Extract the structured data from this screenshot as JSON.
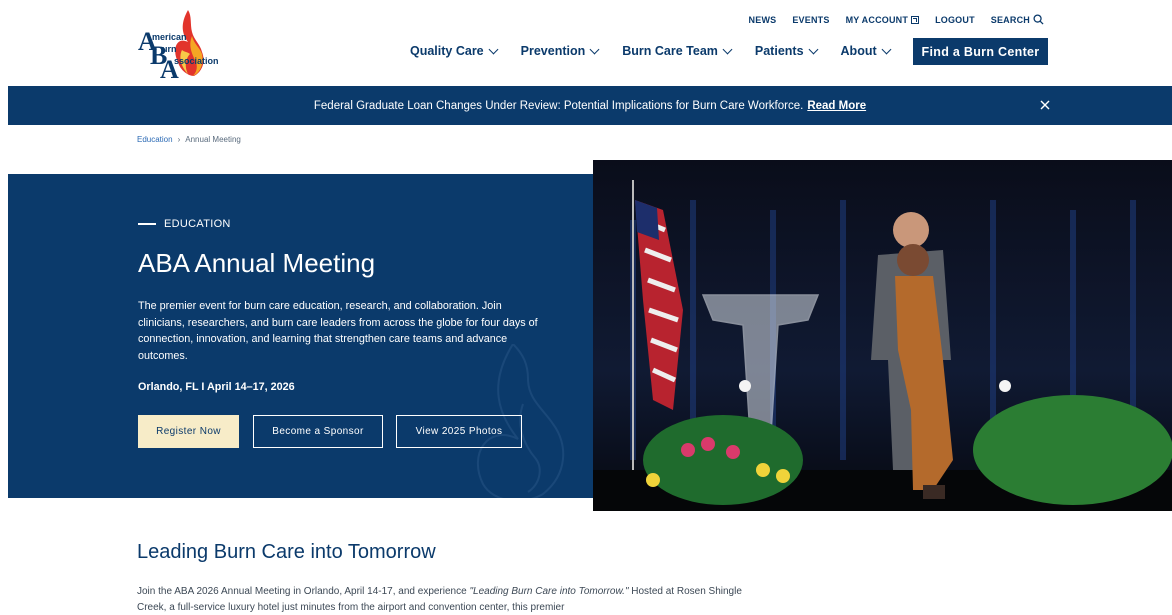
{
  "logo": {
    "text_lines": [
      "merican",
      "urn",
      "ssociation"
    ],
    "letters": [
      "A",
      "B",
      "A"
    ]
  },
  "utility_nav": [
    {
      "label": "NEWS"
    },
    {
      "label": "EVENTS"
    },
    {
      "label": "MY ACCOUNT",
      "icon": "external-link-icon"
    },
    {
      "label": "LOGOUT"
    },
    {
      "label": "SEARCH",
      "icon": "search-icon"
    }
  ],
  "main_nav": [
    {
      "label": "Quality Care"
    },
    {
      "label": "Prevention"
    },
    {
      "label": "Burn Care Team"
    },
    {
      "label": "Patients"
    },
    {
      "label": "About"
    }
  ],
  "find_button": "Find a Burn Center",
  "banner": {
    "text": "Federal Graduate Loan Changes Under Review: Potential Implications for Burn Care Workforce.",
    "link": "Read More"
  },
  "breadcrumb": {
    "parent": "Education",
    "separator": "›",
    "current": "Annual Meeting"
  },
  "hero": {
    "eyebrow": "EDUCATION",
    "title": "ABA Annual Meeting",
    "description": "The premier event for burn care education, research, and collaboration. Join clinicians, researchers, and burn care leaders from across the globe for four days of connection, innovation, and learning that strengthen care teams and advance outcomes.",
    "location": "Orlando, FL I April 14–17, 2026",
    "buttons": {
      "register": "Register Now",
      "sponsor": "Become a Sponsor",
      "photos": "View 2025 Photos"
    }
  },
  "section": {
    "title": "Leading Burn Care into Tomorrow",
    "body_start": "Join the ABA 2026 Annual Meeting in Orlando, April 14-17, and experience ",
    "body_italic": "\"Leading Burn Care into Tomorrow.\"",
    "body_end": " Hosted at Rosen Shingle Creek, a full-service luxury hotel just minutes from the airport and convention center, this premier"
  },
  "colors": {
    "brand_navy": "#0b3a6b",
    "register_button": "#f7ecc8",
    "link_blue": "#2d6bb5"
  }
}
